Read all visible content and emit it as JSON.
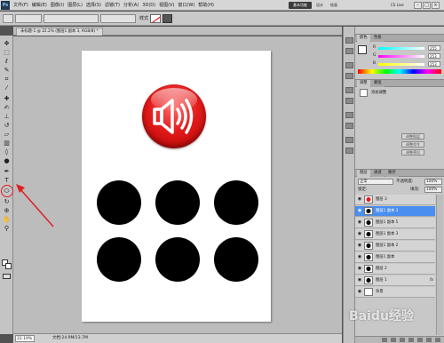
{
  "app": {
    "logo_text": "Ps"
  },
  "menubar": {
    "items": [
      "文件(F)",
      "编辑(E)",
      "图像(I)",
      "图层(L)",
      "选择(S)",
      "滤镜(T)",
      "分析(A)",
      "3D(D)",
      "视图(V)",
      "窗口(W)",
      "帮助(H)"
    ],
    "zoom_select": "22.2",
    "workspace_active": "基本功能",
    "workspace_links": [
      "设计",
      "绘画"
    ],
    "cslive": "CS Live",
    "window_buttons": [
      "–",
      "□",
      "×"
    ]
  },
  "options_bar": {
    "style_label": "样式"
  },
  "document_tab": {
    "title": "未标题-1 @ 22.2% (图层1 副本 3, RGB/8) *"
  },
  "canvas": {
    "accent_red": "#e31c1c",
    "button_icon": "speaker-with-sound-waves-icon"
  },
  "status": {
    "zoom": "22.19%",
    "doc_size": "文档:24.9M/13.7M"
  },
  "color_panel": {
    "tabs": [
      "颜色",
      "色板"
    ],
    "sliders": [
      {
        "label": "R",
        "value": "255"
      },
      {
        "label": "G",
        "value": "253"
      },
      {
        "label": "B",
        "value": "253"
      }
    ]
  },
  "styles_panel": {
    "tabs": [
      "调整",
      "蒙版"
    ],
    "label": "添加调整",
    "buttons": [
      "调整图层",
      "调整命令",
      "调整预设"
    ]
  },
  "layers_panel": {
    "tabs": [
      "图层",
      "通道",
      "路径"
    ],
    "blend_mode": "正常",
    "opacity_label": "不透明度:",
    "opacity_value": "100%",
    "lock_label": "锁定:",
    "fill_label": "填充:",
    "fill_value": "100%",
    "layers": [
      {
        "name": "图层 3",
        "thumb": "red",
        "selected": false,
        "fx": ""
      },
      {
        "name": "图层1 副本 3",
        "thumb": "black",
        "selected": true,
        "fx": ""
      },
      {
        "name": "图层1 副本 5",
        "thumb": "black",
        "selected": false,
        "fx": ""
      },
      {
        "name": "图层1 副本 3",
        "thumb": "black",
        "selected": false,
        "fx": ""
      },
      {
        "name": "图层1 副本 2",
        "thumb": "black",
        "selected": false,
        "fx": ""
      },
      {
        "name": "图层1 副本",
        "thumb": "black",
        "selected": false,
        "fx": ""
      },
      {
        "name": "图层 2",
        "thumb": "black",
        "selected": false,
        "fx": ""
      },
      {
        "name": "图层 1",
        "thumb": "black",
        "selected": false,
        "fx": "fx"
      },
      {
        "name": "背景",
        "thumb": "white",
        "selected": false,
        "fx": ""
      }
    ]
  },
  "watermark": "Baidu经验"
}
